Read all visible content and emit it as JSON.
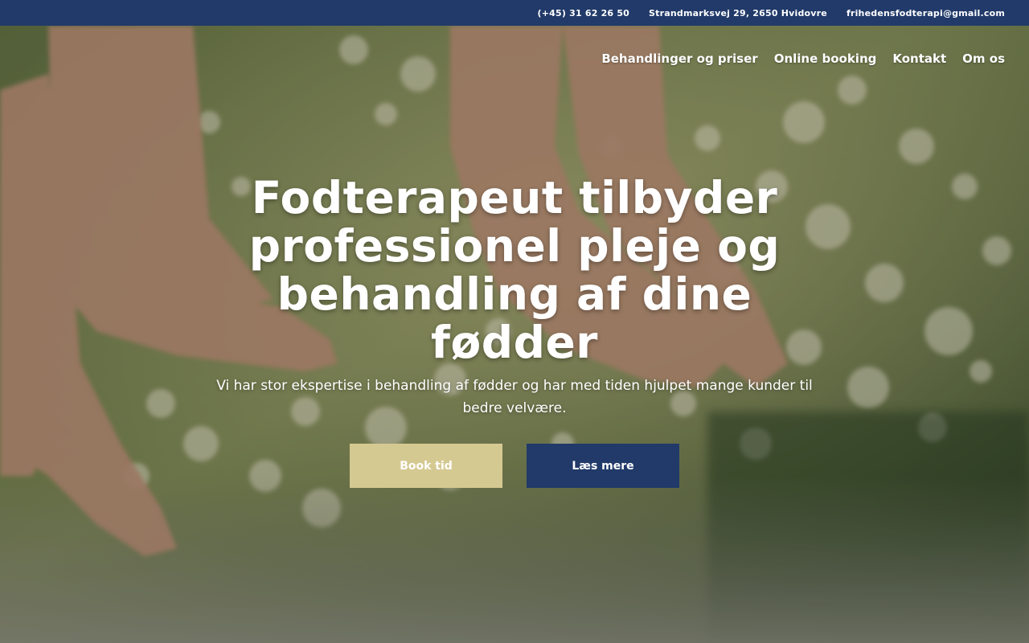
{
  "topbar": {
    "phone": "(+45) 31 62 26 50",
    "address": "Strandmarksvej 29, 2650 Hvidovre",
    "email": "frihedensfodterapi@gmail.com"
  },
  "nav": {
    "items": [
      "Behandlinger og priser",
      "Online booking",
      "Kontakt",
      "Om os"
    ]
  },
  "hero": {
    "headline": "Fodterapeut tilbyder professionel pleje og behandling af dine fødder",
    "subline": "Vi har stor ekspertise i behandling af fødder og har med tiden hjulpet mange kunder til bedre velvære.",
    "book_label": "Book tid",
    "more_label": "Læs mere"
  },
  "colors": {
    "navy": "#213a69",
    "gold": "#d5c992",
    "white": "#ffffff"
  }
}
